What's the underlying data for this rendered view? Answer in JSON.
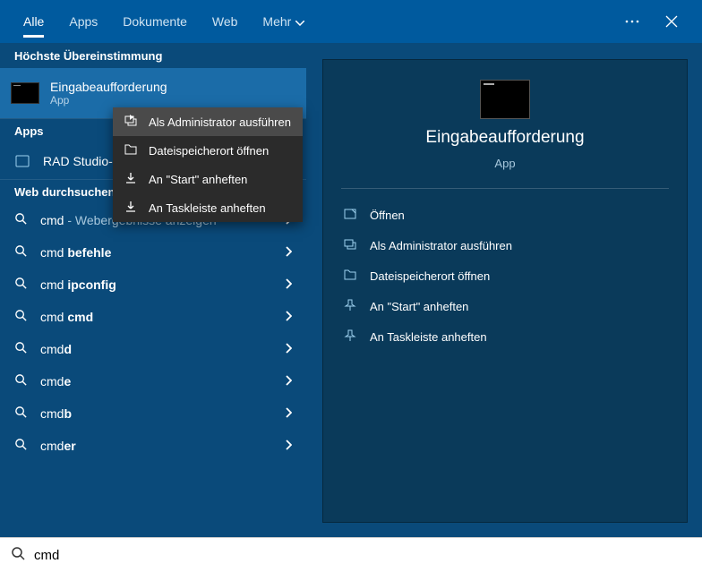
{
  "tabs": {
    "all": "Alle",
    "apps": "Apps",
    "docs": "Dokumente",
    "web": "Web",
    "more": "Mehr"
  },
  "sections": {
    "bestmatch": "Höchste Übereinstimmung",
    "apps": "Apps",
    "websearch": "Web durchsuchen"
  },
  "bestmatch": {
    "title": "Eingabeaufforderung",
    "subtitle": "App"
  },
  "apps_list": [
    {
      "label": "RAD Studio-..."
    }
  ],
  "websearch_hint": "Webergebnisse anzeigen",
  "web_queries": [
    "cmd",
    "cmd befehle",
    "cmd ipconfig",
    "cmd cmd",
    "cmdd",
    "cmde",
    "cmdb",
    "cmder"
  ],
  "web_bold_from": [
    null,
    null,
    null,
    4,
    3,
    3,
    3,
    3
  ],
  "context_menu": [
    "Als Administrator ausführen",
    "Dateispeicherort öffnen",
    "An \"Start\" anheften",
    "An Taskleiste anheften"
  ],
  "details": {
    "title": "Eingabeaufforderung",
    "type": "App"
  },
  "actions": [
    "Öffnen",
    "Als Administrator ausführen",
    "Dateispeicherort öffnen",
    "An \"Start\" anheften",
    "An Taskleiste anheften"
  ],
  "search_value": "cmd"
}
